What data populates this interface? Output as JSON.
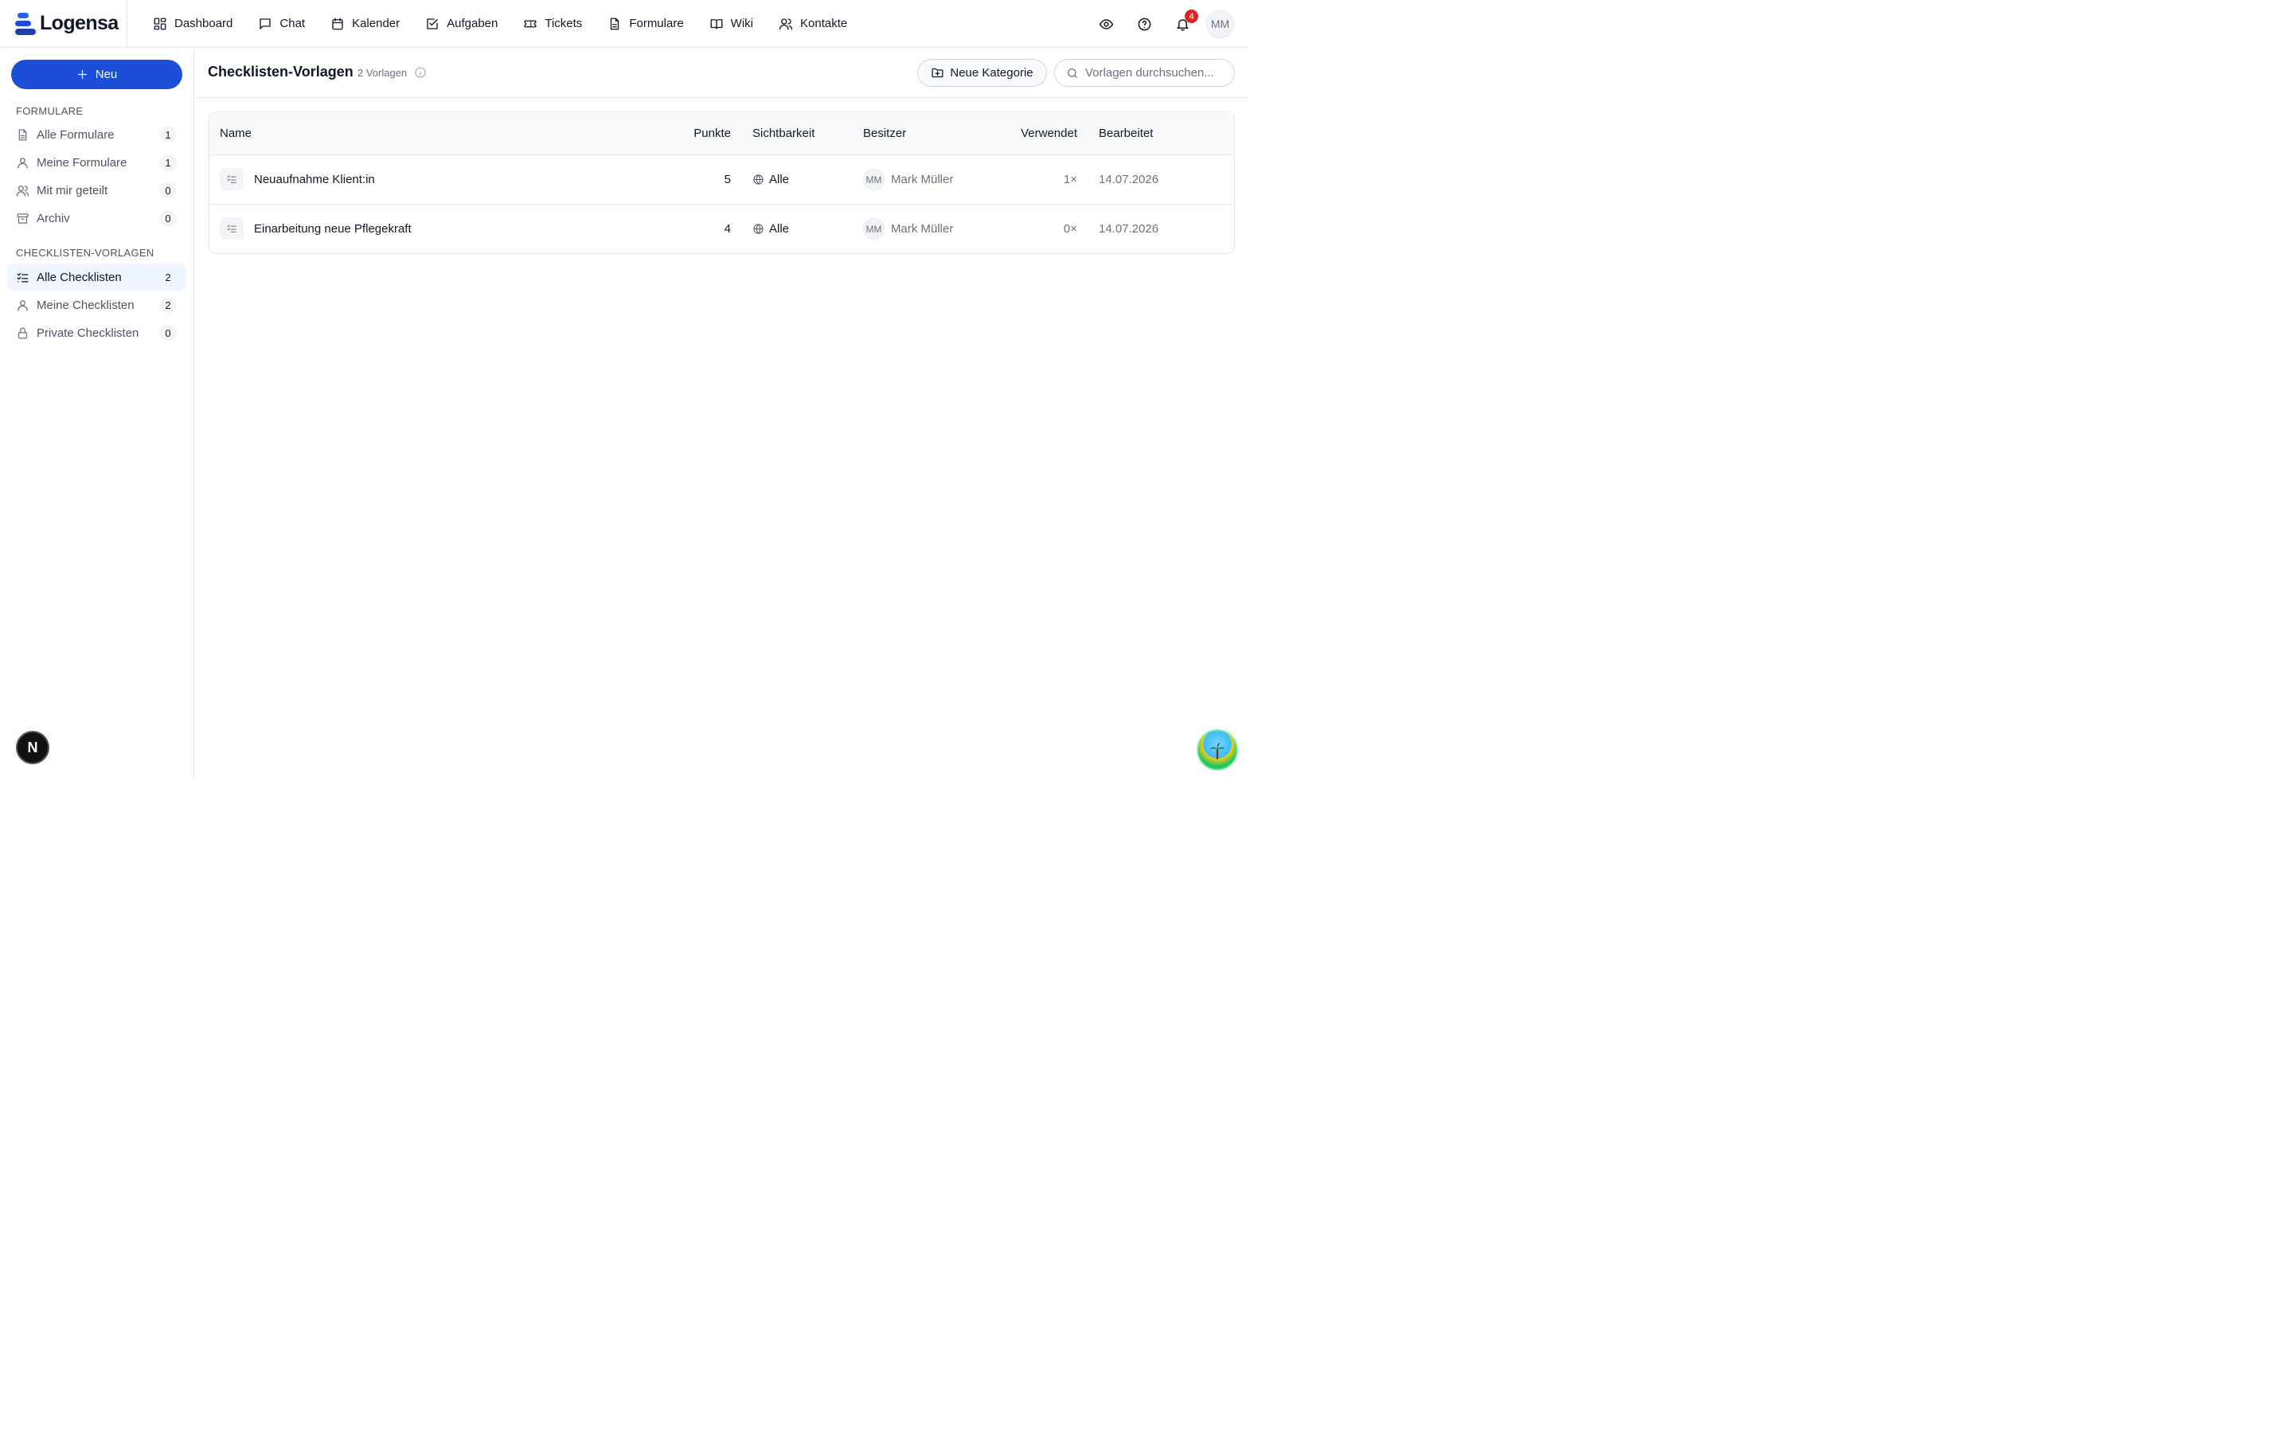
{
  "app": {
    "logo_text": "Logensa",
    "brand_color": "#1d4ed8"
  },
  "nav": {
    "items": [
      {
        "label": "Dashboard",
        "icon": "dashboard-icon"
      },
      {
        "label": "Chat",
        "icon": "chat-icon"
      },
      {
        "label": "Kalender",
        "icon": "calendar-icon"
      },
      {
        "label": "Aufgaben",
        "icon": "task-icon"
      },
      {
        "label": "Tickets",
        "icon": "ticket-icon"
      },
      {
        "label": "Formulare",
        "icon": "form-icon"
      },
      {
        "label": "Wiki",
        "icon": "book-icon"
      },
      {
        "label": "Kontakte",
        "icon": "contacts-icon"
      }
    ]
  },
  "topbar": {
    "notification_count": "4",
    "user_initials": "MM"
  },
  "sidebar": {
    "new_button_label": "Neu",
    "forms_section_label": "FORMULARE",
    "forms_items": [
      {
        "label": "Alle Formulare",
        "count": "1"
      },
      {
        "label": "Meine Formulare",
        "count": "1"
      },
      {
        "label": "Mit mir geteilt",
        "count": "0"
      },
      {
        "label": "Archiv",
        "count": "0"
      }
    ],
    "checklists_section_label": "CHECKLISTEN-VORLAGEN",
    "checklist_items": [
      {
        "label": "Alle Checklisten",
        "count": "2",
        "active": true
      },
      {
        "label": "Meine Checklisten",
        "count": "2"
      },
      {
        "label": "Private Checklisten",
        "count": "0"
      }
    ],
    "floating_badge_letter": "N"
  },
  "main": {
    "title": "Checklisten-Vorlagen",
    "count_label": "2 Vorlagen",
    "new_category_label": "Neue Kategorie",
    "search_placeholder": "Vorlagen durchsuchen..."
  },
  "table": {
    "headers": {
      "name": "Name",
      "points": "Punkte",
      "visibility": "Sichtbarkeit",
      "owner": "Besitzer",
      "used": "Verwendet",
      "edited": "Bearbeitet"
    },
    "rows": [
      {
        "name": "Neuaufnahme Klient:in",
        "points": "5",
        "visibility": "Alle",
        "owner_initials": "MM",
        "owner": "Mark Müller",
        "used": "1×",
        "edited": "14.07.2026"
      },
      {
        "name": "Einarbeitung neue Pflegekraft",
        "points": "4",
        "visibility": "Alle",
        "owner_initials": "MM",
        "owner": "Mark Müller",
        "used": "0×",
        "edited": "14.07.2026"
      }
    ]
  }
}
